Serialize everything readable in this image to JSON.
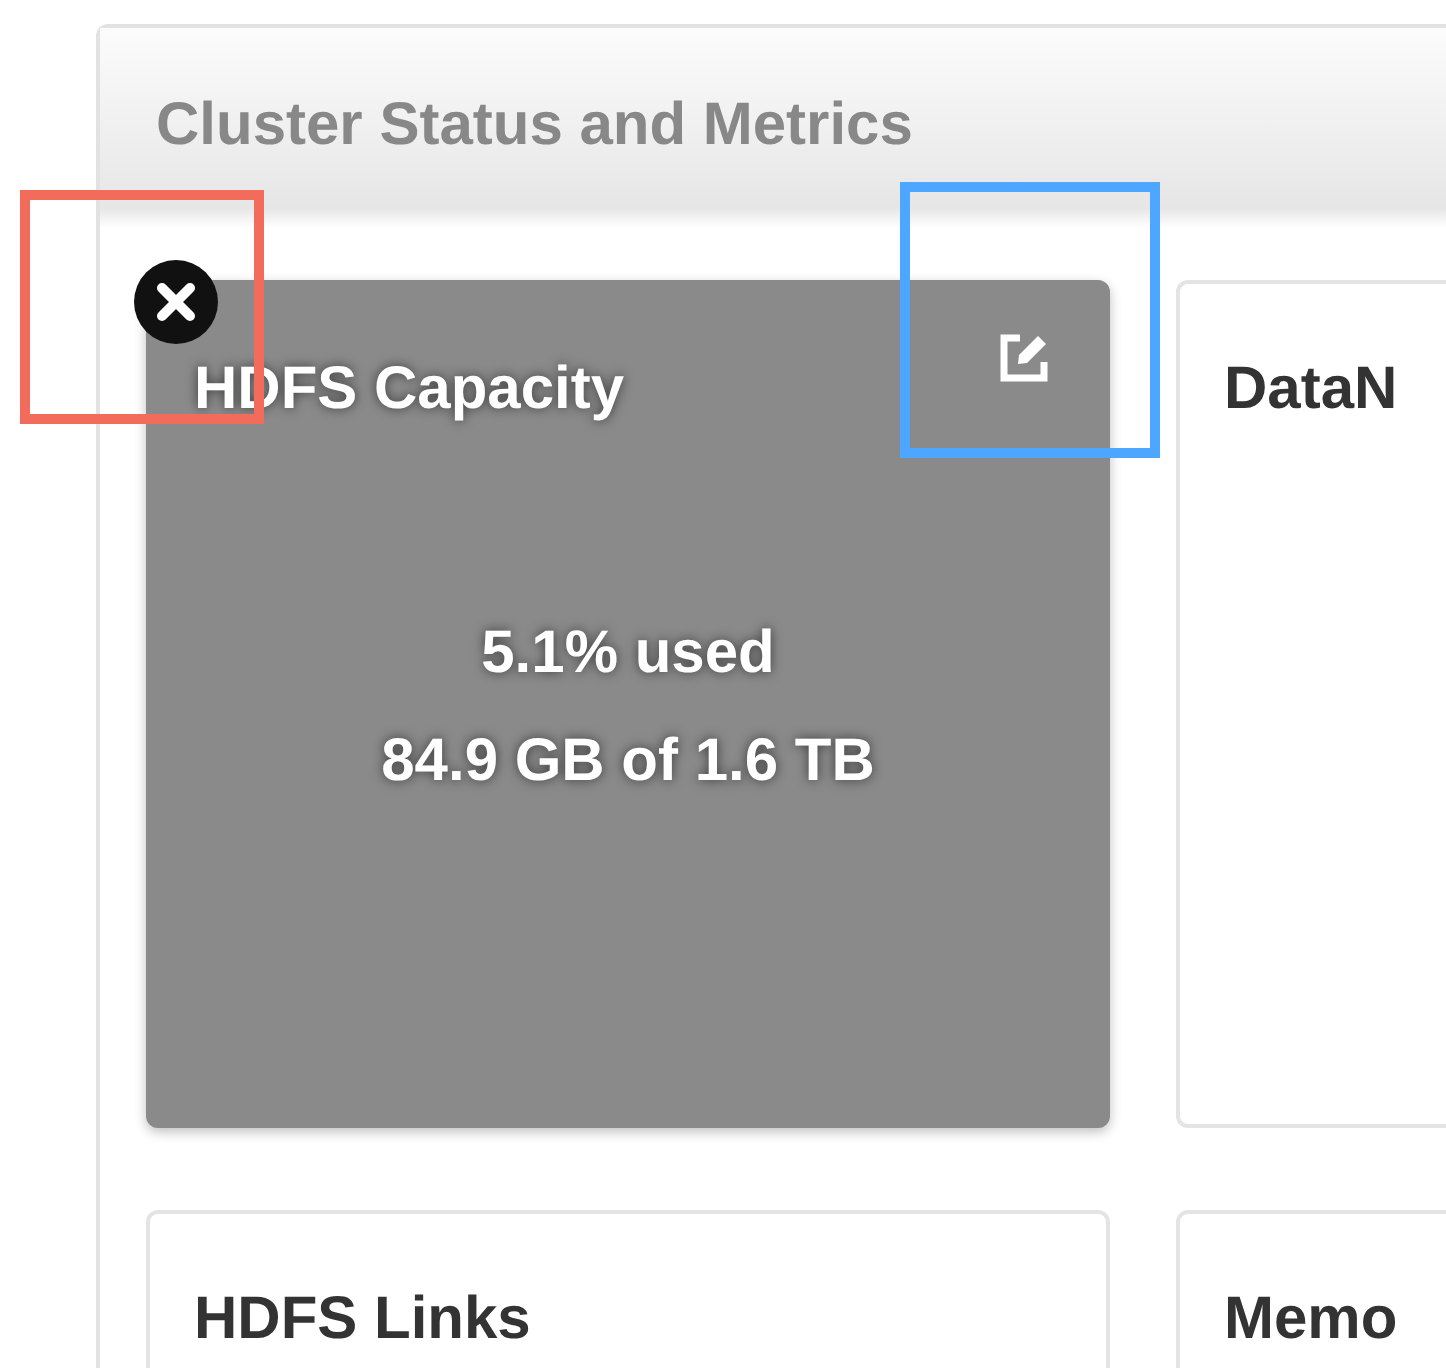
{
  "panel": {
    "title": "Cluster Status and Metrics"
  },
  "widgets": [
    {
      "title": "HDFS Capacity",
      "highlighted": true,
      "lines": [
        "5.1% used",
        "84.9 GB of 1.6 TB"
      ]
    },
    {
      "title": "DataN",
      "highlighted": false
    },
    {
      "title": "HDFS Links",
      "highlighted": false
    },
    {
      "title": "Memo",
      "highlighted": false
    }
  ],
  "annotations": [
    {
      "color": "#f26b5b"
    },
    {
      "color": "#4da6ff"
    }
  ]
}
